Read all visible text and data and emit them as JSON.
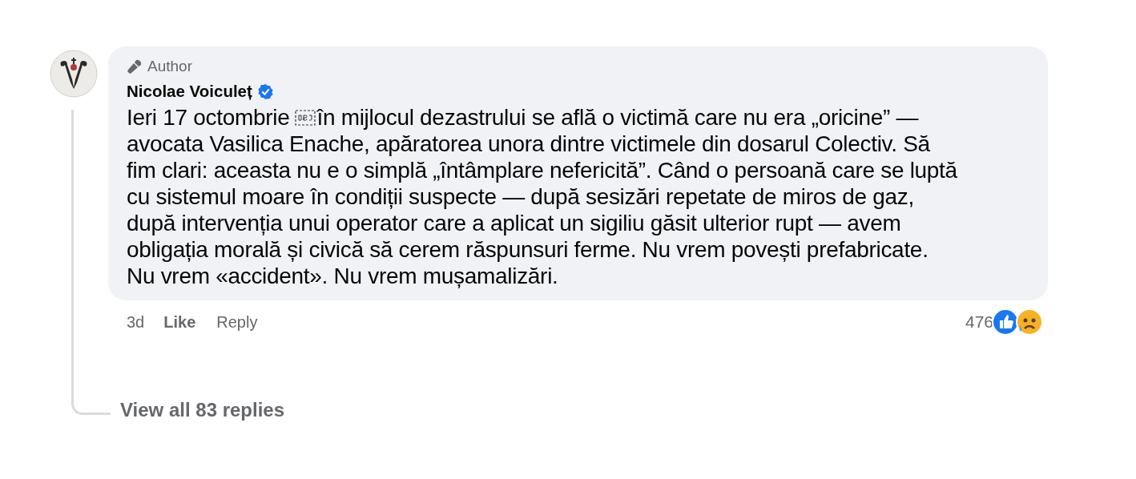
{
  "comment": {
    "badge": "Author",
    "author": "Nicolae Voiculeț",
    "verified": true,
    "text_start": "Ieri 17 octombrie",
    "text_first_line": "în mijlocul dezastrului se află o victimă care nu era „oricine” —",
    "text_lines": [
      "avocata Vasilica Enache, apăratorea unora dintre victimele din dosarul Colectiv. Să",
      "fim clari: aceasta nu e o simplă „întâmplare nefericită”. Când o persoană care se luptă",
      "cu sistemul moare în condiții suspecte — după sesizări repetate de miros de gaz,",
      "după intervenția unui operator care a aplicat un sigiliu găsit ulterior rupt — avem",
      "obligația morală și civică să cerem răspunsuri ferme. Nu vrem povești prefabricate.",
      "Nu vrem «accident». Nu vrem mușamalizări."
    ],
    "time": "3d",
    "actions": [
      "Like",
      "Reply"
    ],
    "reaction_count": "476",
    "reactions": [
      {
        "kind": "like"
      },
      {
        "kind": "sad"
      }
    ],
    "view_replies": "View all 83 replies"
  }
}
